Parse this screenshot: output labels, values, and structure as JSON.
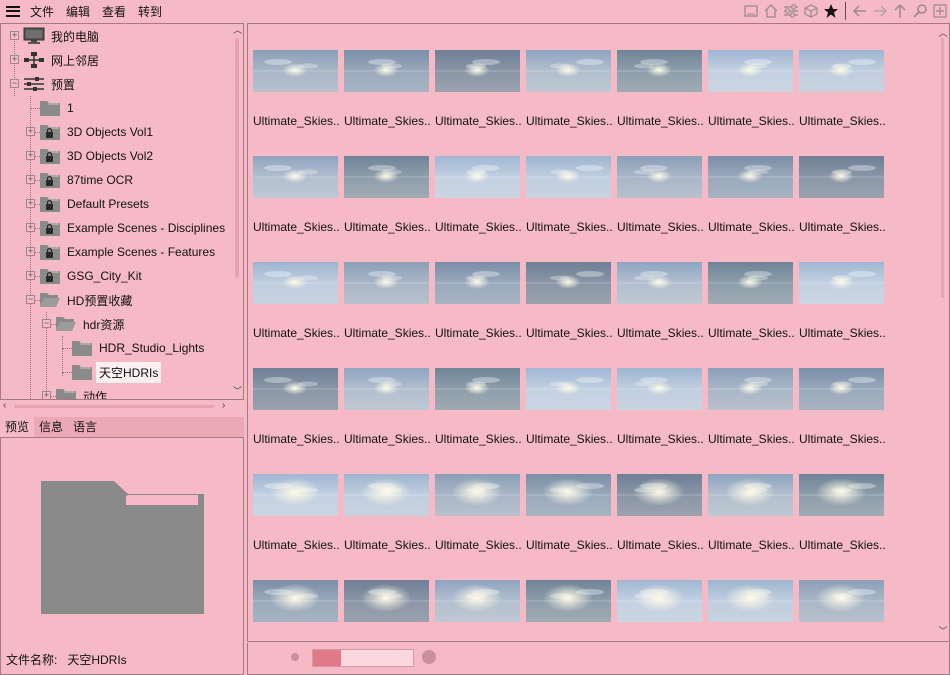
{
  "menu": [
    "文件",
    "编辑",
    "查看",
    "转到"
  ],
  "toolbar_icons": [
    "window-icon",
    "home-icon",
    "filter-settings-icon",
    "package-icon",
    "star-icon",
    "back-arrow-icon",
    "forward-arrow-icon",
    "up-arrow-icon",
    "search-icon",
    "add-icon"
  ],
  "tree": {
    "items": [
      {
        "label": "我的电脑",
        "icon": "computer-icon"
      },
      {
        "label": "网上邻居",
        "icon": "network-icon"
      },
      {
        "label": "预置",
        "icon": "presets-icon"
      },
      {
        "label": "1",
        "icon": "folder-icon"
      },
      {
        "label": "3D Objects Vol1",
        "icon": "locked-folder-icon"
      },
      {
        "label": "3D Objects Vol2",
        "icon": "locked-folder-icon"
      },
      {
        "label": "87time OCR",
        "icon": "locked-folder-icon"
      },
      {
        "label": "Default Presets",
        "icon": "locked-folder-icon"
      },
      {
        "label": "Example Scenes - Disciplines",
        "icon": "locked-folder-icon"
      },
      {
        "label": "Example Scenes - Features",
        "icon": "locked-folder-icon"
      },
      {
        "label": "GSG_City_Kit",
        "icon": "locked-folder-icon"
      },
      {
        "label": "HD预置收藏",
        "icon": "open-folder-icon"
      },
      {
        "label": "hdr资源",
        "icon": "open-folder-icon"
      },
      {
        "label": "HDR_Studio_Lights",
        "icon": "folder-icon"
      },
      {
        "label": "天空HDRIs",
        "icon": "folder-icon",
        "selected": true
      },
      {
        "label": "动作",
        "icon": "folder-icon"
      }
    ]
  },
  "preview": {
    "tabs": [
      "预览",
      "信息",
      "语言"
    ],
    "active_tab": "预览",
    "filename_label": "文件名称:",
    "filename_value": "天空HDRIs"
  },
  "grid": {
    "item_label": "Ultimate_Skies..",
    "rows": 6,
    "cols": 7
  },
  "zoom": {
    "value": 0.28
  },
  "colors": {
    "background": "#f5bac5",
    "panel_border": "#a67a84",
    "folder_gray": "#8a8a8a",
    "selection": "#fbeff1",
    "slider_fill": "#e07a86"
  }
}
